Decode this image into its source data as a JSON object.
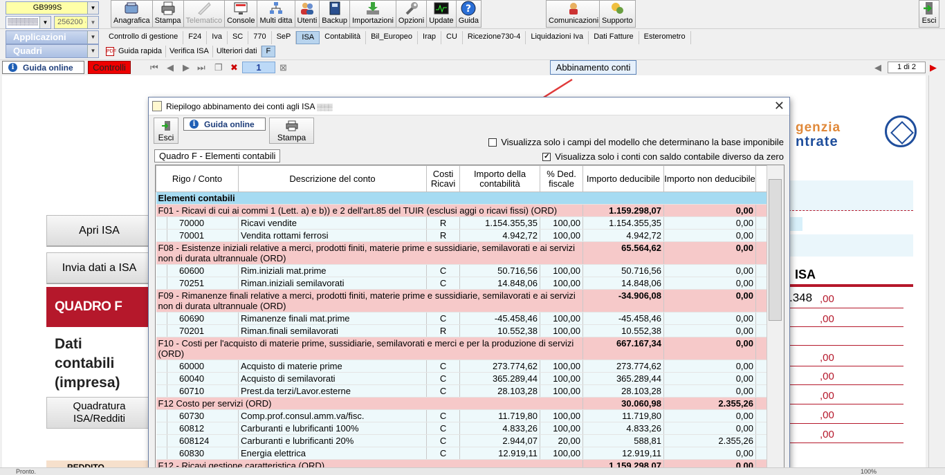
{
  "toolbar": {
    "client_combo": "GB999S",
    "code_combo": "▒▒▒▒▒▒▒▒",
    "year_combo": "256200 -",
    "buttons": [
      {
        "label": "Anagrafica",
        "icon": "anagrafica-icon",
        "enabled": true
      },
      {
        "label": "Stampa",
        "icon": "printer-icon",
        "enabled": true
      },
      {
        "label": "Telematico",
        "icon": "telematico-icon",
        "enabled": false
      },
      {
        "label": "Console",
        "icon": "console-icon",
        "enabled": true
      },
      {
        "label": "Multi ditta",
        "icon": "multi-ditta-icon",
        "enabled": true
      },
      {
        "label": "Utenti",
        "icon": "users-icon",
        "enabled": true
      },
      {
        "label": "Backup",
        "icon": "backup-icon",
        "enabled": true
      },
      {
        "label": "Importazioni",
        "icon": "import-icon",
        "enabled": true
      },
      {
        "label": "Opzioni",
        "icon": "wrench-icon",
        "enabled": true
      },
      {
        "label": "Update",
        "icon": "update-icon",
        "enabled": true
      },
      {
        "label": "Guida",
        "icon": "help-icon",
        "enabled": true
      }
    ],
    "comunicazioni": "Comunicazioni",
    "supporto": "Supporto",
    "esci": "Esci"
  },
  "menu": {
    "applicazioni": "Applicazioni",
    "quadri": "Quadri",
    "tabs": [
      "Controllo di gestione",
      "F24",
      "Iva",
      "SC",
      "770",
      "SeP",
      "ISA",
      "Contabilità",
      "Bil_Europeo",
      "Irap",
      "CU",
      "Ricezione730-4",
      "Liquidazioni Iva",
      "Dati Fatture",
      "Esterometro"
    ],
    "active_tab": "ISA",
    "subtabs": [
      "Guida rapida",
      "Verifica ISA",
      "Ulteriori dati",
      "F"
    ],
    "active_subtab": "F"
  },
  "nav": {
    "guida_online": "Guida online",
    "controlli": "Controlli",
    "page": "1",
    "abbinamento": "Abbinamento conti",
    "page_indicator": "1 di 2"
  },
  "document": {
    "apri_isa": "Apri ISA",
    "invia_dati": "Invia dati a ISA",
    "quadro_f": "QUADRO F",
    "dati_line1": "Dati",
    "dati_line2": "contabili",
    "dati_line3": "(impresa)",
    "quadratura_line1": "Quadratura",
    "quadratura_line2": "ISA/Redditi",
    "reddito": "REDDITO",
    "agenzia_line1": "genzia",
    "agenzia_line2": "ntrate",
    "isa_label": "ISA",
    "value_348": ".348",
    "cents": ",00"
  },
  "dialog": {
    "title": "Riepilogo abbinamento dei conti agli ISA",
    "title_suffix": "▒▒▒▒",
    "esci": "Esci",
    "guida_online": "Guida online",
    "stampa": "Stampa",
    "chk_campi": "Visualizza solo i campi del modello che determinano la base imponibile",
    "chk_campi_checked": false,
    "chk_saldo": "Visualizza solo i conti con saldo contabile diverso da zero",
    "chk_saldo_checked": true,
    "section_title": "Quadro F - Elementi contabili",
    "columns": [
      "Rigo / Conto",
      "Descrizione del conto",
      "Costi Ricavi",
      "Importo della contabilità",
      "% Ded. fiscale",
      "Importo deducibile",
      "Importo non deducibile"
    ],
    "section_row": "Elementi contabili",
    "groups": [
      {
        "desc": "F01 - Ricavi di cui ai commi 1 (Lett. a) e b)) e 2 dell'art.85 del TUIR (esclusi aggi o ricavi fissi) (ORD)",
        "deducibile": "1.159.298,07",
        "non_deducibile": "0,00",
        "accounts": [
          {
            "code": "70000",
            "desc": "Ricavi vendite",
            "cr": "R",
            "importo": "1.154.355,35",
            "perc": "100,00",
            "ded": "1.154.355,35",
            "nonded": "0,00"
          },
          {
            "code": "70001",
            "desc": "Vendita rottami ferrosi",
            "cr": "R",
            "importo": "4.942,72",
            "perc": "100,00",
            "ded": "4.942,72",
            "nonded": "0,00"
          }
        ]
      },
      {
        "desc": "F08 - Esistenze iniziali relative a merci, prodotti finiti, materie prime e sussidiarie, semilavorati e ai servizi non di durata ultrannuale (ORD)",
        "deducibile": "65.564,62",
        "non_deducibile": "0,00",
        "accounts": [
          {
            "code": "60600",
            "desc": "Rim.iniziali mat.prime",
            "cr": "C",
            "importo": "50.716,56",
            "perc": "100,00",
            "ded": "50.716,56",
            "nonded": "0,00"
          },
          {
            "code": "70251",
            "desc": "Riman.iniziali semilavorati",
            "cr": "C",
            "importo": "14.848,06",
            "perc": "100,00",
            "ded": "14.848,06",
            "nonded": "0,00"
          }
        ]
      },
      {
        "desc": "F09 - Rimanenze finali relative a merci, prodotti finiti, materie prime e sussidiarie, semilavorati e ai servizi non di durata ultrannuale (ORD)",
        "deducibile": "-34.906,08",
        "non_deducibile": "0,00",
        "accounts": [
          {
            "code": "60690",
            "desc": "Rimanenze finali mat.prime",
            "cr": "C",
            "importo": "-45.458,46",
            "perc": "100,00",
            "ded": "-45.458,46",
            "nonded": "0,00"
          },
          {
            "code": "70201",
            "desc": "Riman.finali semilavorati",
            "cr": "R",
            "importo": "10.552,38",
            "perc": "100,00",
            "ded": "10.552,38",
            "nonded": "0,00"
          }
        ]
      },
      {
        "desc": "F10 - Costi per l'acquisto di materie prime, sussidiarie, semilavorati e merci e per la produzione di servizi (ORD)",
        "deducibile": "667.167,34",
        "non_deducibile": "0,00",
        "accounts": [
          {
            "code": "60000",
            "desc": "Acquisto di materie prime",
            "cr": "C",
            "importo": "273.774,62",
            "perc": "100,00",
            "ded": "273.774,62",
            "nonded": "0,00"
          },
          {
            "code": "60040",
            "desc": "Acquisto di semilavorati",
            "cr": "C",
            "importo": "365.289,44",
            "perc": "100,00",
            "ded": "365.289,44",
            "nonded": "0,00"
          },
          {
            "code": "60710",
            "desc": "Prest.da terzi/Lavor.esterne",
            "cr": "C",
            "importo": "28.103,28",
            "perc": "100,00",
            "ded": "28.103,28",
            "nonded": "0,00"
          }
        ]
      },
      {
        "desc": "F12 Costo per servizi (ORD)",
        "deducibile": "30.060,98",
        "non_deducibile": "2.355,26",
        "accounts": [
          {
            "code": "60730",
            "desc": "Comp.prof.consul.amm.va/fisc.",
            "cr": "C",
            "importo": "11.719,80",
            "perc": "100,00",
            "ded": "11.719,80",
            "nonded": "0,00"
          },
          {
            "code": "60812",
            "desc": "Carburanti e lubrificanti 100%",
            "cr": "C",
            "importo": "4.833,26",
            "perc": "100,00",
            "ded": "4.833,26",
            "nonded": "0,00"
          },
          {
            "code": "608124",
            "desc": "Carburanti e lubrificanti 20%",
            "cr": "C",
            "importo": "2.944,07",
            "perc": "20,00",
            "ded": "588,81",
            "nonded": "2.355,26"
          },
          {
            "code": "60830",
            "desc": "Energia elettrica",
            "cr": "C",
            "importo": "12.919,11",
            "perc": "100,00",
            "ded": "12.919,11",
            "nonded": "0,00"
          }
        ]
      },
      {
        "desc": "F12 - Ricavi gestione caratteristica (ORD)",
        "deducibile": "1.159.298,07",
        "non_deducibile": "0,00",
        "accounts": []
      }
    ]
  },
  "status": {
    "text": "Pronto.",
    "zoom": "100%"
  },
  "colors": {
    "group_row": "#f6c9c9",
    "account_row": "#eef9fb",
    "section_row": "#a6dbf2",
    "accent_red": "#b5182b"
  }
}
